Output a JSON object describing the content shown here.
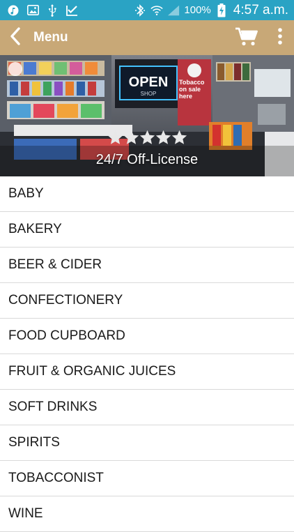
{
  "status_bar": {
    "battery_percent": "100%",
    "time": "4:57 a.m.",
    "icons": [
      "music-icon",
      "image-icon",
      "usb-icon",
      "download-check-icon",
      "bluetooth-icon",
      "wifi-icon",
      "signal-icon",
      "battery-charging-icon"
    ]
  },
  "app_bar": {
    "title": "Menu",
    "background_color": "#c8a877",
    "icons": [
      "back-arrow-icon",
      "cart-icon",
      "more-vertical-icon"
    ]
  },
  "hero": {
    "store_name": "24/7 Off-License",
    "rating": 5,
    "sign_text": "OPEN",
    "sign_subtext": "SHOP",
    "poster_text": "Tobacco on sale here"
  },
  "categories": [
    {
      "label": "BABY"
    },
    {
      "label": "BAKERY"
    },
    {
      "label": "BEER & CIDER"
    },
    {
      "label": "CONFECTIONERY"
    },
    {
      "label": "FOOD CUPBOARD"
    },
    {
      "label": "FRUIT & ORGANIC JUICES"
    },
    {
      "label": "SOFT DRINKS"
    },
    {
      "label": "SPIRITS"
    },
    {
      "label": "TOBACCONIST"
    },
    {
      "label": "WINE"
    }
  ]
}
